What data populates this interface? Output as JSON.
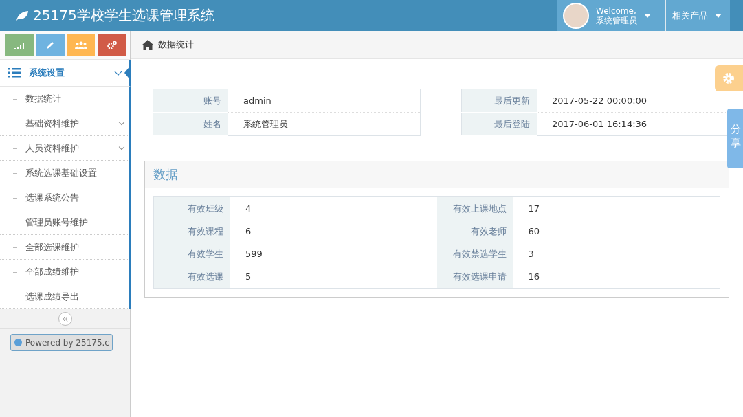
{
  "header": {
    "title": "25175学校学生选课管理系统",
    "user_greeting": "Welcome,",
    "user_name": "系统管理员",
    "products_menu": "相关产品"
  },
  "breadcrumb": "数据统计",
  "sidebar": {
    "group": {
      "label": "系统设置",
      "expanded": true
    },
    "items": [
      {
        "label": "数据统计",
        "expandable": false
      },
      {
        "label": "基础资料维护",
        "expandable": true
      },
      {
        "label": "人员资料维护",
        "expandable": true
      },
      {
        "label": "系统选课基础设置",
        "expandable": false
      },
      {
        "label": "选课系统公告",
        "expandable": false
      },
      {
        "label": "管理员账号维护",
        "expandable": false
      },
      {
        "label": "全部选课维护",
        "expandable": false
      },
      {
        "label": "全部成绩维护",
        "expandable": false
      },
      {
        "label": "选课成绩导出",
        "expandable": false
      }
    ],
    "powered_by": "Powered by 25175.c"
  },
  "account_info": [
    [
      {
        "label": "账号",
        "value": "admin"
      },
      {
        "label": "姓名",
        "value": "系统管理员"
      }
    ],
    [
      {
        "label": "最后更新",
        "value": "2017-05-22 00:00:00"
      },
      {
        "label": "最后登陆",
        "value": "2017-06-01 16:14:36"
      }
    ]
  ],
  "data_panel": {
    "title": "数据",
    "left": [
      {
        "label": "有效班级",
        "value": "4"
      },
      {
        "label": "有效课程",
        "value": "6"
      },
      {
        "label": "有效学生",
        "value": "599"
      },
      {
        "label": "有效选课",
        "value": "5"
      }
    ],
    "right": [
      {
        "label": "有效上课地点",
        "value": "17"
      },
      {
        "label": "有效老师",
        "value": "60"
      },
      {
        "label": "有效禁选学生",
        "value": "3"
      },
      {
        "label": "有效选课申请",
        "value": "16"
      }
    ]
  },
  "share_tab": "分享"
}
